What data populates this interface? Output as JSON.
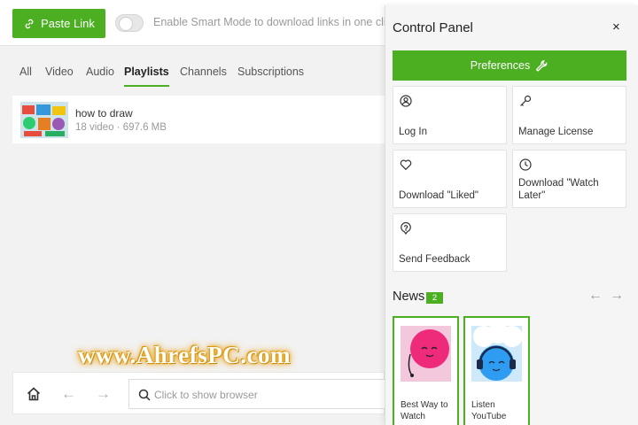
{
  "topbar": {
    "paste_label": "Paste Link",
    "paste_icon": "link-plus-icon",
    "smart_mode_label": "Enable Smart Mode to download links in one click",
    "smart_mode_enabled": false
  },
  "tabs": [
    {
      "label": "All",
      "active": false
    },
    {
      "label": "Video",
      "active": false
    },
    {
      "label": "Audio",
      "active": false
    },
    {
      "label": "Playlists",
      "active": true
    },
    {
      "label": "Channels",
      "active": false
    },
    {
      "label": "Subscriptions",
      "active": false
    }
  ],
  "playlist": {
    "title": "how to draw",
    "meta": "18 video · 697.6 MB"
  },
  "bottombar": {
    "browser_placeholder": "Click to show browser"
  },
  "watermark": "www.AhrefsPC.com",
  "panel": {
    "title": "Control Panel",
    "close_glyph": "×",
    "preferences_label": "Preferences",
    "cards": [
      {
        "label": "Log In",
        "icon": "user-icon"
      },
      {
        "label": "Manage License",
        "icon": "key-icon"
      },
      {
        "label": "Download \"Liked\"",
        "icon": "heart-icon"
      },
      {
        "label": "Download \"Watch Later\"",
        "icon": "clock-icon"
      },
      {
        "label": "Send Feedback",
        "icon": "feedback-icon"
      }
    ],
    "news": {
      "label": "News",
      "count": "2",
      "items": [
        {
          "caption": "Best Way to Watch"
        },
        {
          "caption": "Listen YouTube"
        }
      ]
    }
  },
  "colors": {
    "accent": "#4caf22",
    "background": "#f2f2f2",
    "panel_bg": "#f5f5f5"
  }
}
